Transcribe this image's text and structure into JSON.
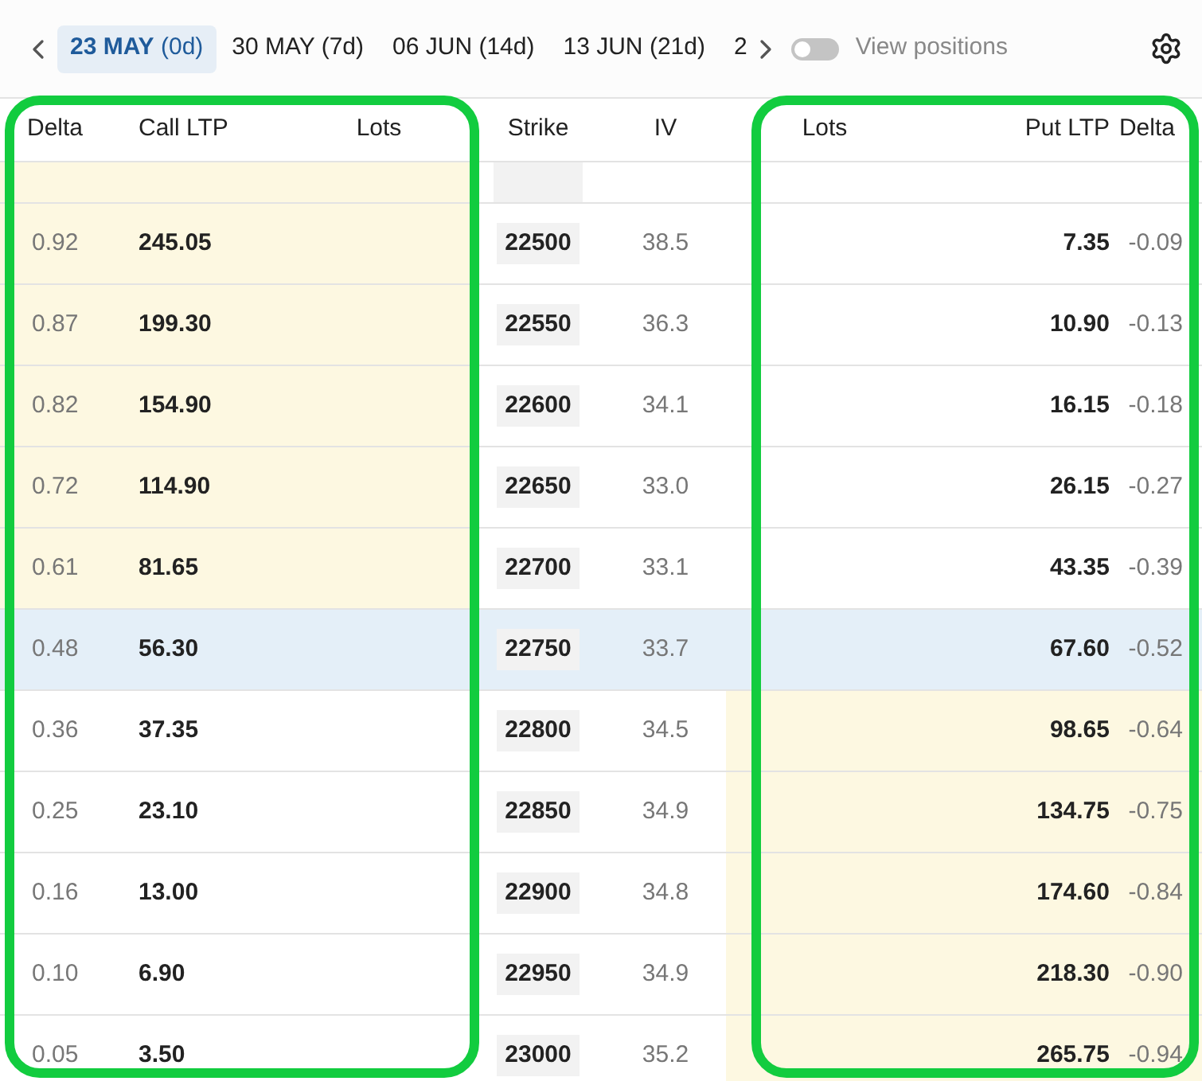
{
  "expiry_tabs": [
    {
      "date": "23 MAY",
      "days": "(0d)",
      "selected": true
    },
    {
      "date": "30 MAY",
      "days": "(7d)",
      "selected": false
    },
    {
      "date": "06 JUN",
      "days": "(14d)",
      "selected": false
    },
    {
      "date": "13 JUN",
      "days": "(21d)",
      "selected": false
    },
    {
      "date": "2",
      "selected": false
    }
  ],
  "view_positions": {
    "label": "View positions",
    "on": false
  },
  "columns": [
    "Delta",
    "Call LTP",
    "Lots",
    "Strike",
    "IV",
    "Lots",
    "Put LTP",
    "Delta"
  ],
  "rows": [
    {
      "kind": "call_itm",
      "call_delta": "0.92",
      "call_ltp": "245.05",
      "strike": "22500",
      "iv": "38.5",
      "put_ltp": "7.35",
      "put_delta": "-0.09"
    },
    {
      "kind": "call_itm",
      "call_delta": "0.87",
      "call_ltp": "199.30",
      "strike": "22550",
      "iv": "36.3",
      "put_ltp": "10.90",
      "put_delta": "-0.13"
    },
    {
      "kind": "call_itm",
      "call_delta": "0.82",
      "call_ltp": "154.90",
      "strike": "22600",
      "iv": "34.1",
      "put_ltp": "16.15",
      "put_delta": "-0.18"
    },
    {
      "kind": "call_itm",
      "call_delta": "0.72",
      "call_ltp": "114.90",
      "strike": "22650",
      "iv": "33.0",
      "put_ltp": "26.15",
      "put_delta": "-0.27"
    },
    {
      "kind": "call_itm",
      "call_delta": "0.61",
      "call_ltp": "81.65",
      "strike": "22700",
      "iv": "33.1",
      "put_ltp": "43.35",
      "put_delta": "-0.39"
    },
    {
      "kind": "atm",
      "call_delta": "0.48",
      "call_ltp": "56.30",
      "strike": "22750",
      "iv": "33.7",
      "put_ltp": "67.60",
      "put_delta": "-0.52"
    },
    {
      "kind": "put_itm",
      "call_delta": "0.36",
      "call_ltp": "37.35",
      "strike": "22800",
      "iv": "34.5",
      "put_ltp": "98.65",
      "put_delta": "-0.64"
    },
    {
      "kind": "put_itm",
      "call_delta": "0.25",
      "call_ltp": "23.10",
      "strike": "22850",
      "iv": "34.9",
      "put_ltp": "134.75",
      "put_delta": "-0.75"
    },
    {
      "kind": "put_itm",
      "call_delta": "0.16",
      "call_ltp": "13.00",
      "strike": "22900",
      "iv": "34.8",
      "put_ltp": "174.60",
      "put_delta": "-0.84"
    },
    {
      "kind": "put_itm",
      "call_delta": "0.10",
      "call_ltp": "6.90",
      "strike": "22950",
      "iv": "34.9",
      "put_ltp": "218.30",
      "put_delta": "-0.90"
    },
    {
      "kind": "put_itm",
      "call_delta": "0.05",
      "call_ltp": "3.50",
      "strike": "23000",
      "iv": "35.2",
      "put_ltp": "265.75",
      "put_delta": "-0.94"
    }
  ]
}
